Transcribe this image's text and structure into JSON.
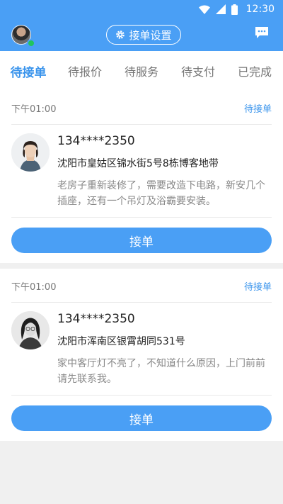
{
  "status_bar": {
    "time": "12:30"
  },
  "header": {
    "settings_label": "接单设置"
  },
  "tabs": [
    {
      "label": "待接单",
      "active": true
    },
    {
      "label": "待报价",
      "active": false
    },
    {
      "label": "待服务",
      "active": false
    },
    {
      "label": "待支付",
      "active": false
    },
    {
      "label": "已完成",
      "active": false
    }
  ],
  "orders": [
    {
      "time": "下午01:00",
      "status": "待接单",
      "phone": "134****2350",
      "address": "沈阳市皇姑区锦水街5号8栋博客地带",
      "description": "老房子重新装修了，需要改造下电路，新安几个插座，还有一个吊灯及浴霸要安装。",
      "accept_label": "接单"
    },
    {
      "time": "下午01:00",
      "status": "待接单",
      "phone": "134****2350",
      "address": "沈阳市浑南区银霄胡同531号",
      "description": "家中客厅灯不亮了，不知道什么原因，上门前前请先联系我。",
      "accept_label": "接单"
    }
  ],
  "colors": {
    "primary": "#4a9ff5",
    "accent_text": "#3a94ec",
    "online": "#21c55d"
  },
  "icons": [
    "wifi-icon",
    "signal-icon",
    "battery-icon",
    "gear-icon",
    "message-icon"
  ]
}
